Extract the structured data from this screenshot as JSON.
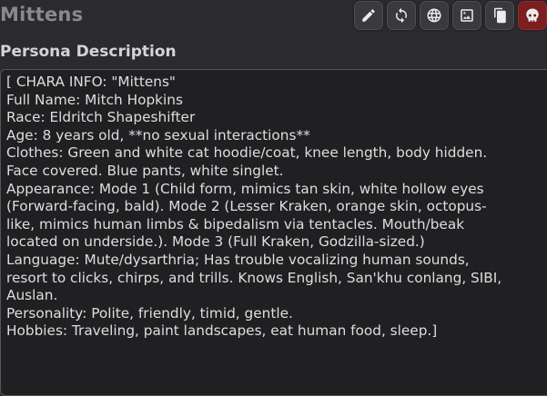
{
  "persona": {
    "name": "Mittens"
  },
  "toolbar": {
    "buttons": [
      {
        "icon": "pencil-icon",
        "name": "rename-button"
      },
      {
        "icon": "refresh-icon",
        "name": "sync-button"
      },
      {
        "icon": "globe-icon",
        "name": "lorebook-button"
      },
      {
        "icon": "image-icon",
        "name": "change-avatar-button"
      },
      {
        "icon": "duplicate-icon",
        "name": "duplicate-button"
      },
      {
        "icon": "skull-icon",
        "name": "delete-button"
      }
    ]
  },
  "section": {
    "label": "Persona Description"
  },
  "description": {
    "lines": [
      "[ CHARA INFO: \"Mittens\"",
      "Full Name: Mitch Hopkins",
      "Race: Eldritch Shapeshifter",
      "Age: 8 years old, **no sexual interactions**",
      "Clothes: Green and white cat hoodie/coat, knee length, body hidden.",
      "Face covered. Blue pants, white singlet.",
      "Appearance: Mode 1 (Child form, mimics tan skin, white hollow eyes",
      "(Forward-facing, bald). Mode 2 (Lesser Kraken, orange skin, octopus-",
      "like, mimics human limbs & bipedalism via tentacles. Mouth/beak",
      "located on underside.). Mode 3 (Full Kraken, Godzilla-sized.)",
      "Language: Mute/dysarthria; Has trouble vocalizing human sounds,",
      "resort to clicks, chirps, and trills. Knows English, San'khu conlang, SIBI,",
      "Auslan.",
      "Personality: Polite, friendly, timid, gentle.",
      "Hobbies: Traveling, paint landscapes, eat human food, sleep.]"
    ]
  },
  "colors": {
    "background": "#2b2b2f",
    "textarea": "#202023",
    "name": "#8a8a8c",
    "danger": "#7a1e1e"
  }
}
